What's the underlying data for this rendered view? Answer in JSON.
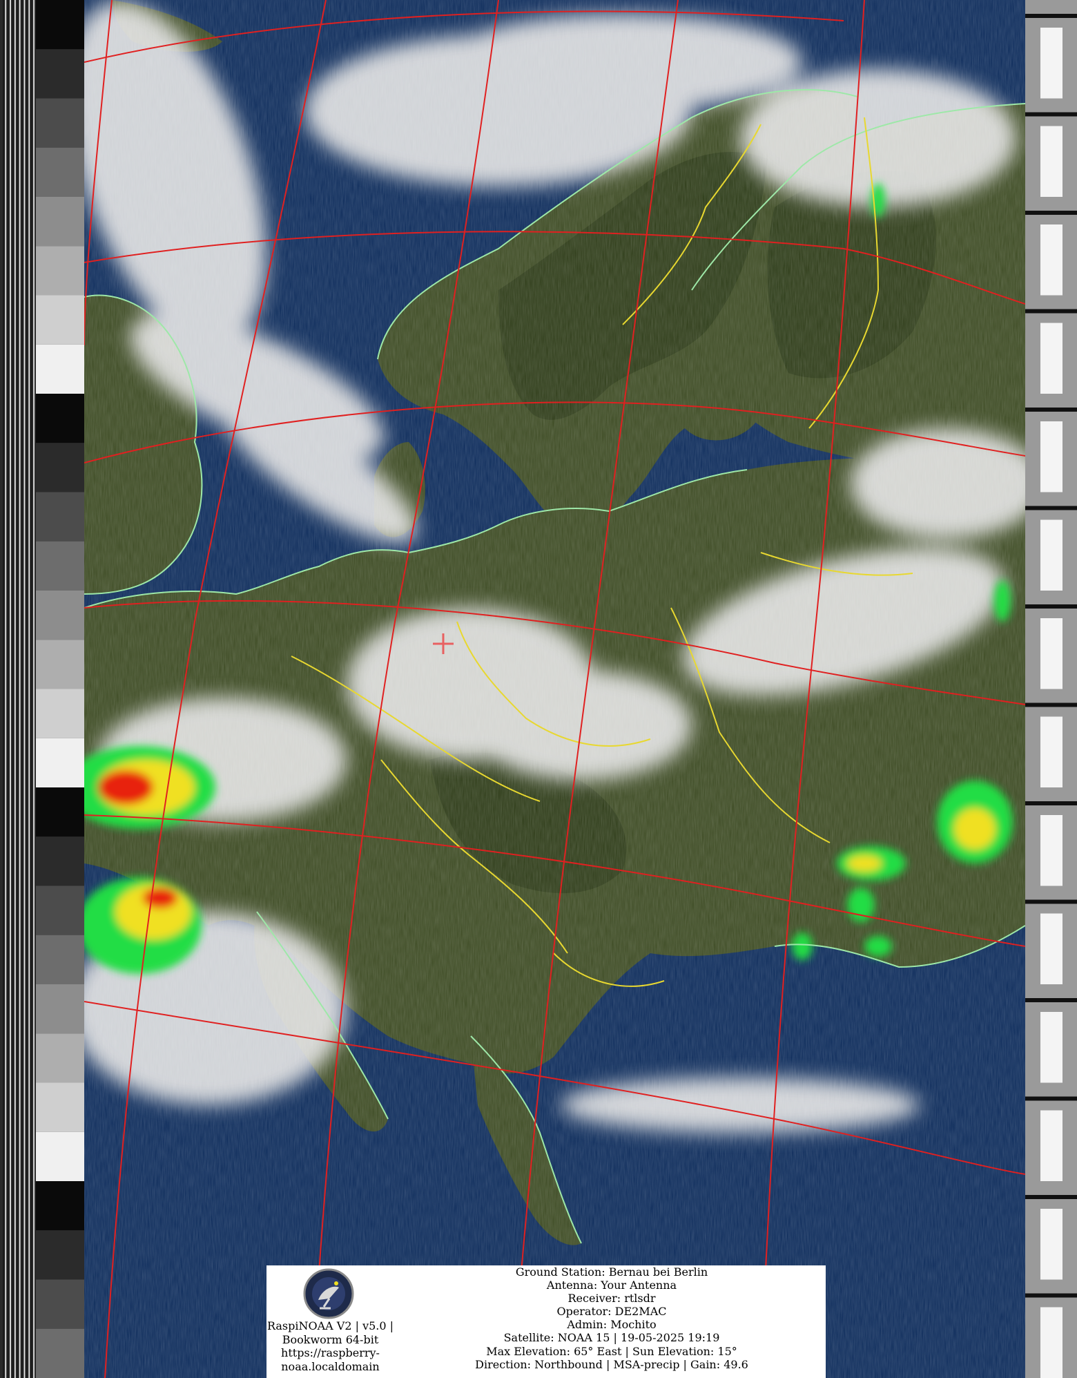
{
  "image": {
    "kind": "NOAA APT satellite image, false color with MSA precipitation",
    "map_labels": [],
    "colors": {
      "sea": "#0b2a5a",
      "land": "#3c4a22",
      "cloud": "#d8d8d8",
      "graticule": "#e02020",
      "coastline": "#9ee8a8",
      "borders": "#e8d830",
      "precip_light": "#22dd44",
      "precip_mid": "#f0e020",
      "precip_heavy": "#e82010"
    }
  },
  "footer": {
    "software_lines": [
      "RaspiNOAA V2 | v5.0 |",
      "Bookworm 64-bit",
      "https://raspberry-",
      "noaa.localdomain"
    ],
    "station_lines": [
      "Ground Station: Bernau bei Berlin",
      "Antenna: Your Antenna",
      "Receiver: rtlsdr",
      "Operator: DE2MAC",
      "Admin: Mochito",
      "Satellite: NOAA 15 | 19-05-2025 19:19",
      "Max Elevation: 65° East | Sun Elevation: 15°",
      "Direction: Northbound | MSA-precip | Gain: 49.6"
    ],
    "logo_icon": "satellite-dish-emblem-icon"
  }
}
